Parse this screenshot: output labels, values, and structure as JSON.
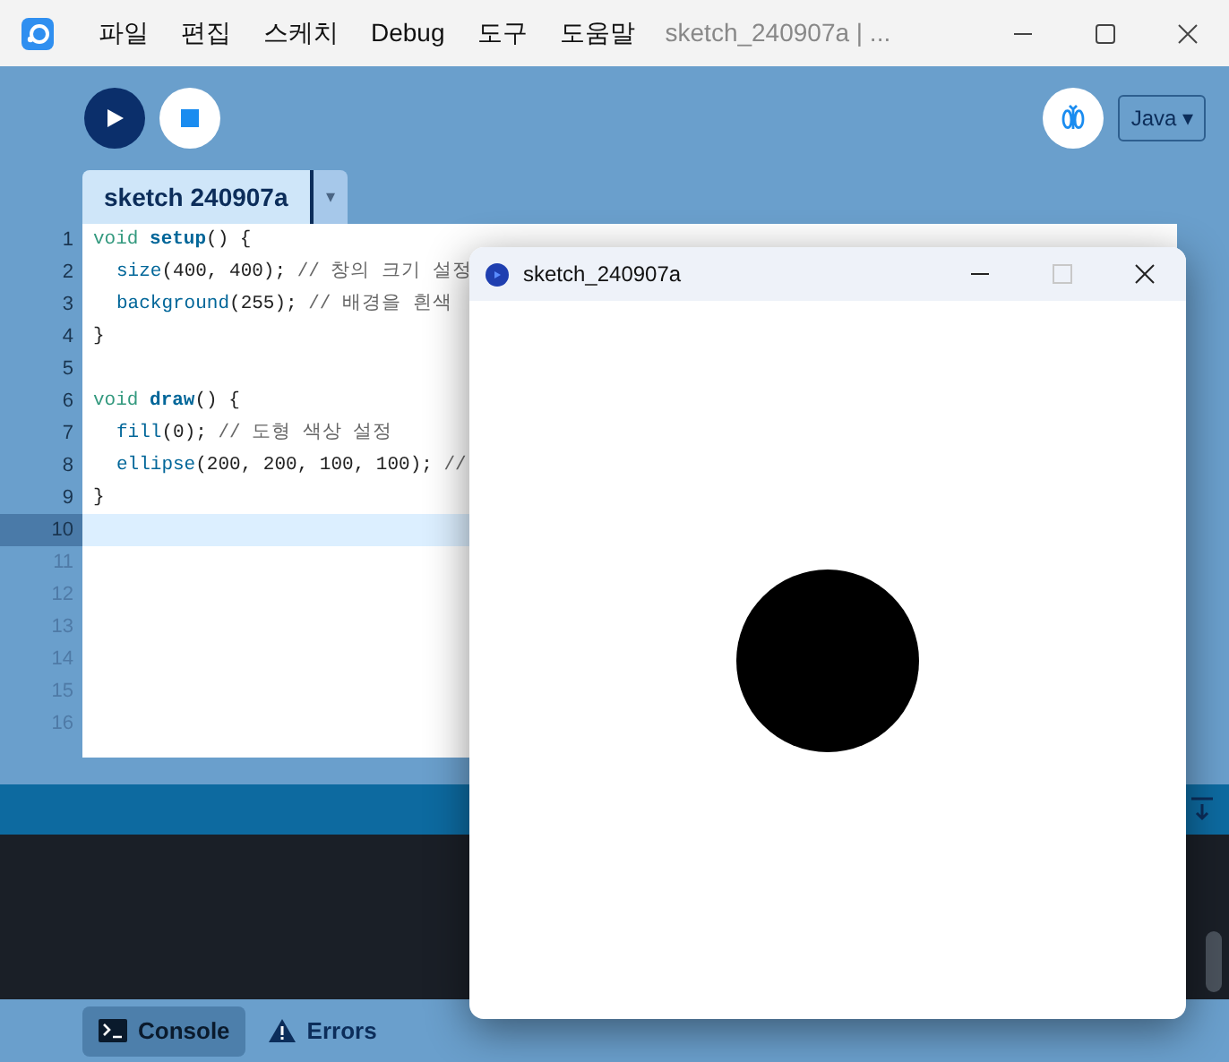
{
  "app_window": {
    "title": "sketch_240907a | ...",
    "menu": [
      "파일",
      "편집",
      "스케치",
      "Debug",
      "도구",
      "도움말"
    ]
  },
  "toolbar": {
    "mode": "Java ▾"
  },
  "tabs": [
    {
      "label": "sketch 240907a",
      "selected": true
    }
  ],
  "tab_menu": "▾",
  "editor": {
    "lines": [
      {
        "number": "1",
        "current": false,
        "faded": false,
        "indented": false,
        "segments": [
          {
            "text": "void ",
            "kind": "keyword"
          },
          {
            "text": "setup",
            "kind": "function"
          },
          {
            "text": "() {",
            "kind": "plain"
          }
        ]
      },
      {
        "number": "2",
        "current": false,
        "faded": false,
        "indented": true,
        "segments": [
          {
            "text": "size",
            "kind": "builtin"
          },
          {
            "text": "(400, 400); ",
            "kind": "plain"
          },
          {
            "text": "// 창의 크기 설정",
            "kind": "comment"
          }
        ]
      },
      {
        "number": "3",
        "current": false,
        "faded": false,
        "indented": true,
        "segments": [
          {
            "text": "background",
            "kind": "builtin"
          },
          {
            "text": "(255); ",
            "kind": "plain"
          },
          {
            "text": "// 배경을 흰색",
            "kind": "comment"
          }
        ]
      },
      {
        "number": "4",
        "current": false,
        "faded": false,
        "indented": false,
        "segments": [
          {
            "text": "}",
            "kind": "plain"
          }
        ]
      },
      {
        "number": "5",
        "current": false,
        "faded": false
      },
      {
        "number": "6",
        "current": false,
        "faded": false,
        "indented": false,
        "segments": [
          {
            "text": "void ",
            "kind": "keyword"
          },
          {
            "text": "draw",
            "kind": "function"
          },
          {
            "text": "() {",
            "kind": "plain"
          }
        ]
      },
      {
        "number": "7",
        "current": false,
        "faded": false,
        "indented": true,
        "segments": [
          {
            "text": "fill",
            "kind": "builtin"
          },
          {
            "text": "(0); ",
            "kind": "plain"
          },
          {
            "text": "// 도형 색상 설정",
            "kind": "comment"
          }
        ]
      },
      {
        "number": "8",
        "current": false,
        "faded": false,
        "indented": true,
        "segments": [
          {
            "text": "ellipse",
            "kind": "builtin"
          },
          {
            "text": "(200, 200, 100, 100); ",
            "kind": "plain"
          },
          {
            "text": "//",
            "kind": "comment"
          }
        ]
      },
      {
        "number": "9",
        "current": false,
        "faded": false,
        "indented": false,
        "segments": [
          {
            "text": "}",
            "kind": "plain"
          }
        ]
      },
      {
        "number": "10",
        "current": true,
        "faded": false
      },
      {
        "number": "11",
        "current": false,
        "faded": true
      },
      {
        "number": "12",
        "current": false,
        "faded": true
      },
      {
        "number": "13",
        "current": false,
        "faded": true
      },
      {
        "number": "14",
        "current": false,
        "faded": true
      },
      {
        "number": "15",
        "current": false,
        "faded": true
      },
      {
        "number": "16",
        "current": false,
        "faded": true
      }
    ]
  },
  "console_tabs": [
    {
      "label": "Console",
      "kind": "console",
      "selected": true
    },
    {
      "label": "Errors",
      "kind": "errors",
      "selected": false
    }
  ],
  "sketch_window": {
    "title": "sketch_240907a",
    "maximize_disabled": true
  }
}
